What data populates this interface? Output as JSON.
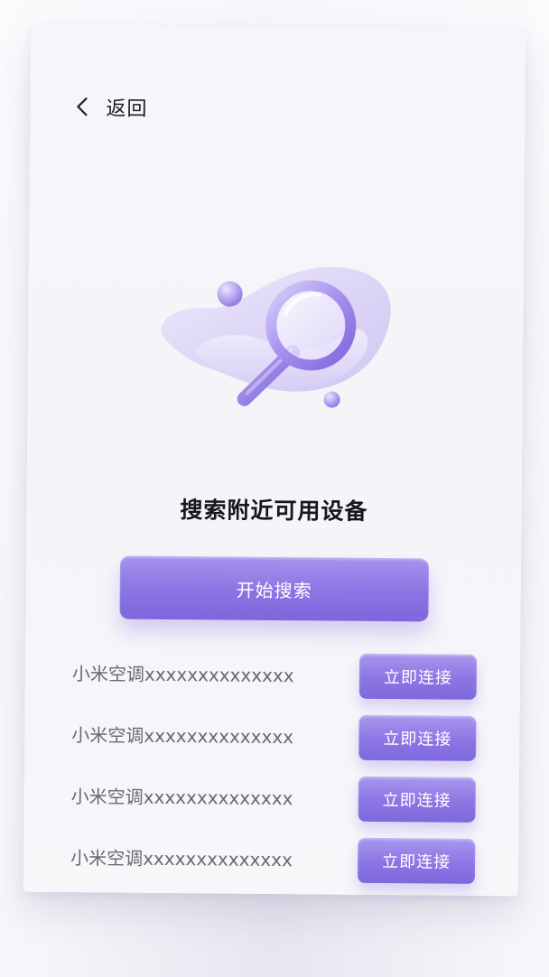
{
  "header": {
    "back_label": "返回",
    "back_icon": "chevron-left-icon"
  },
  "hero": {
    "illustration_icon": "magnifier-icon",
    "title": "搜索附近可用设备"
  },
  "actions": {
    "start_search_label": "开始搜索"
  },
  "devices": [
    {
      "name": "小米空调xxxxxxxxxxxxxx",
      "connect_label": "立即连接"
    },
    {
      "name": "小米空调xxxxxxxxxxxxxx",
      "connect_label": "立即连接"
    },
    {
      "name": "小米空调xxxxxxxxxxxxxx",
      "connect_label": "立即连接"
    },
    {
      "name": "小米空调xxxxxxxxxxxxxx",
      "connect_label": "立即连接"
    }
  ],
  "colors": {
    "accent": "#8b74e2",
    "accent_light": "#a593ee",
    "title_text": "#17151d",
    "body_text": "#6a6872",
    "background": "#f4f4f9"
  }
}
